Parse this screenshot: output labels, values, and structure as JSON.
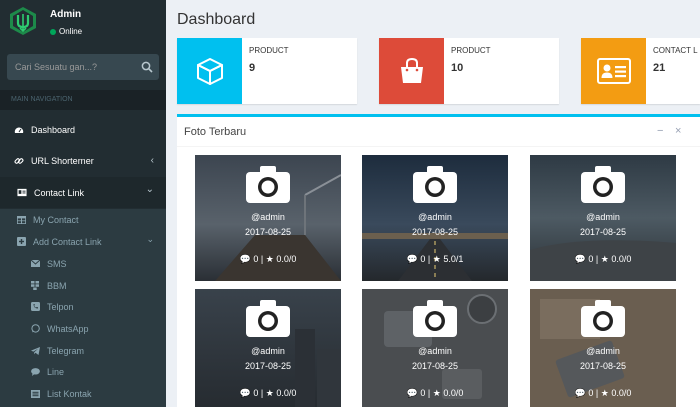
{
  "user": {
    "name": "Admin",
    "status": "Online"
  },
  "search": {
    "placeholder": "Cari Sesuatu gan...?"
  },
  "nav": {
    "header": "MAIN NAVIGATION",
    "items": [
      {
        "label": "Dashboard",
        "icon": "dashboard-icon"
      },
      {
        "label": "URL Shorterner",
        "icon": "link-icon",
        "arrow": "‹"
      },
      {
        "label": "Contact Link",
        "icon": "address-card-icon",
        "arrow": "⌄"
      }
    ],
    "sub": [
      {
        "label": "My Contact",
        "icon": "table-icon"
      },
      {
        "label": "Add Contact Link",
        "icon": "plus-square-icon",
        "arrow": "⌄"
      },
      {
        "label": "SMS",
        "icon": "envelope-icon"
      },
      {
        "label": "BBM",
        "icon": "bbm-icon"
      },
      {
        "label": "Telpon",
        "icon": "phone-icon"
      },
      {
        "label": "WhatsApp",
        "icon": "whatsapp-icon"
      },
      {
        "label": "Telegram",
        "icon": "telegram-icon"
      },
      {
        "label": "Line",
        "icon": "comment-icon"
      },
      {
        "label": "List Kontak",
        "icon": "list-icon"
      }
    ]
  },
  "page": {
    "title": "Dashboard"
  },
  "info_boxes": [
    {
      "label": "PRODUCT",
      "value": "9",
      "color": "#00c0ef",
      "icon": "cube-icon"
    },
    {
      "label": "PRODUCT",
      "value": "10",
      "color": "#dd4b39",
      "icon": "shopping-bag-icon"
    },
    {
      "label": "CONTACT L",
      "value": "21",
      "color": "#f39c12",
      "icon": "id-card-icon"
    }
  ],
  "gallery": {
    "title": "Foto Terbaru",
    "minimize": "−",
    "close": "×",
    "photos": [
      {
        "user": "@admin",
        "date": "2017-08-25",
        "comments": "0",
        "rating": "0.0/0"
      },
      {
        "user": "@admin",
        "date": "2017-08-25",
        "comments": "0",
        "rating": "5.0/1"
      },
      {
        "user": "@admin",
        "date": "2017-08-25",
        "comments": "0",
        "rating": "0.0/0"
      },
      {
        "user": "@admin",
        "date": "2017-08-25",
        "comments": "0",
        "rating": "0.0/0"
      },
      {
        "user": "@admin",
        "date": "2017-08-25",
        "comments": "0",
        "rating": "0.0/0"
      },
      {
        "user": "@admin",
        "date": "2017-08-25",
        "comments": "0",
        "rating": "0.0/0"
      }
    ]
  },
  "colors": {
    "sidebar": "#222d32",
    "accent": "#00c0ef",
    "online": "#00a65a"
  }
}
